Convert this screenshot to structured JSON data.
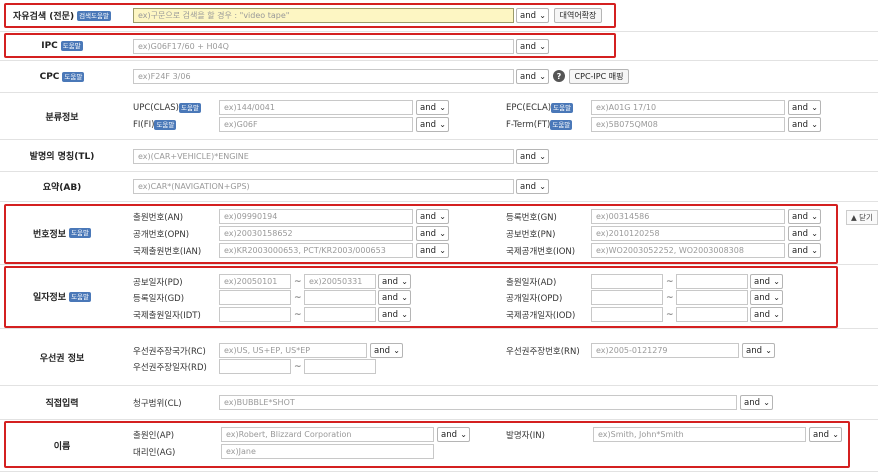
{
  "badge": "도움말",
  "free_search": {
    "label": "자유검색 (전문)",
    "badge": "검색도움말",
    "placeholder": "ex)구문으로 검색을 할 경우 : \"video tape\"",
    "op": "and",
    "expand_button": "대역어확장"
  },
  "ipc": {
    "label": "IPC",
    "placeholder": "ex)G06F17/60 + H04Q",
    "op": "and"
  },
  "cpc": {
    "label": "CPC",
    "placeholder": "ex)F24F 3/06",
    "op": "and",
    "mapping_button": "CPC-IPC 매핑"
  },
  "classification": {
    "label": "분류정보",
    "fields": [
      {
        "label": "UPC(CLAS)",
        "placeholder": "ex)144/0041",
        "op": "and"
      },
      {
        "label": "EPC(ECLA)",
        "placeholder": "ex)A01G 17/10",
        "op": "and"
      },
      {
        "label": "FI(FI)",
        "placeholder": "ex)G06F",
        "op": "and"
      },
      {
        "label": "F-Term(FT)",
        "placeholder": "ex)5B075QM08",
        "op": "and"
      }
    ]
  },
  "title": {
    "label": "발명의 명칭(TL)",
    "placeholder": "ex)(CAR+VEHICLE)*ENGINE",
    "op": "and"
  },
  "abstract": {
    "label": "요약(AB)",
    "placeholder": "ex)CAR*(NAVIGATION+GPS)",
    "op": "and"
  },
  "numbers": {
    "label": "번호정보",
    "fields": [
      {
        "label": "출원번호(AN)",
        "placeholder": "ex)09990194",
        "op": "and"
      },
      {
        "label": "등록번호(GN)",
        "placeholder": "ex)00314586",
        "op": "and"
      },
      {
        "label": "공개번호(OPN)",
        "placeholder": "ex)20030158652",
        "op": "and"
      },
      {
        "label": "공보번호(PN)",
        "placeholder": "ex)2010120258",
        "op": "and"
      },
      {
        "label": "국제출원번호(IAN)",
        "placeholder": "ex)KR2003000653, PCT/KR2003/000653",
        "op": "and"
      },
      {
        "label": "국제공개번호(ION)",
        "placeholder": "ex)WO2003052252, WO2003008308",
        "op": "and"
      }
    ],
    "collapse": "▲ 닫기"
  },
  "dates": {
    "label": "일자정보",
    "fields": [
      {
        "label": "공보일자(PD)",
        "from": "ex)20050101",
        "to": "ex)20050331",
        "op": "and"
      },
      {
        "label": "출원일자(AD)",
        "from": "",
        "to": "",
        "op": "and"
      },
      {
        "label": "등록일자(GD)",
        "from": "",
        "to": "",
        "op": "and"
      },
      {
        "label": "공개일자(OPD)",
        "from": "",
        "to": "",
        "op": "and"
      },
      {
        "label": "국제출원일자(IDT)",
        "from": "",
        "to": "",
        "op": "and"
      },
      {
        "label": "국제공개일자(IOD)",
        "from": "",
        "to": "",
        "op": "and"
      }
    ]
  },
  "priority": {
    "label": "우선권 정보",
    "country": {
      "label": "우선권주장국가(RC)",
      "placeholder": "ex)US, US+EP, US*EP",
      "op": "and"
    },
    "number": {
      "label": "우선권주장번호(RN)",
      "placeholder": "ex)2005-0121279",
      "op": "and"
    },
    "date": {
      "label": "우선권주장일자(RD)",
      "from": "",
      "to": ""
    }
  },
  "direct": {
    "label": "직접입력",
    "claims": {
      "label": "청구범위(CL)",
      "placeholder": "ex)BUBBLE*SHOT",
      "op": "and"
    }
  },
  "names": {
    "label": "이름",
    "fields": [
      {
        "label": "출원인(AP)",
        "placeholder": "ex)Robert, Blizzard Corporation",
        "op": "and"
      },
      {
        "label": "발명자(IN)",
        "placeholder": "ex)Smith, John*Smith",
        "op": "and"
      },
      {
        "label": "대리인(AG)",
        "placeholder": "ex)Jane",
        "op": ""
      }
    ]
  }
}
